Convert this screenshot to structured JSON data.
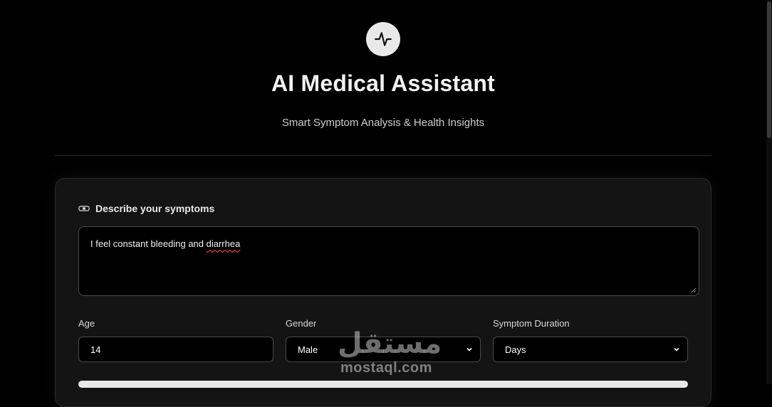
{
  "header": {
    "logo_icon": "activity-pulse-icon",
    "title": "AI Medical Assistant",
    "subtitle": "Smart Symptom Analysis & Health Insights"
  },
  "form": {
    "symptoms_icon": "bandage-icon",
    "symptoms_label": "Describe your symptoms",
    "symptoms_value_before": "I feel constant bleeding and ",
    "symptoms_value_misspelled": "diarrhea",
    "age_label": "Age",
    "age_value": "14",
    "gender_label": "Gender",
    "gender_value": "Male",
    "duration_label": "Symptom Duration",
    "duration_value": "Days"
  },
  "watermark": {
    "arabic": "مستقل",
    "text": "mostaql.com"
  }
}
